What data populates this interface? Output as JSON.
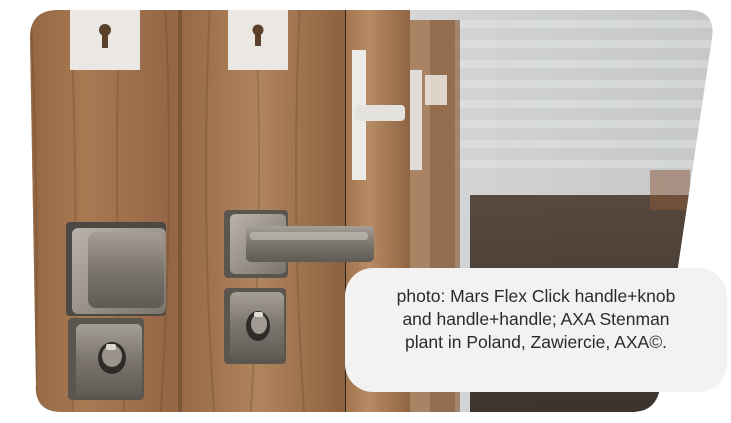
{
  "photo": {
    "subject": "door handles on wooden doors",
    "icons": [
      "handle-plate-icon",
      "knob-plate-icon",
      "keyhole-escutcheon-icon",
      "cylinder-rosette-icon"
    ],
    "colors": {
      "wood": "#9a6c47",
      "metal": "#7d7770",
      "background_blur": "#c9ccce",
      "caption_bg": "#f2f2f2",
      "caption_text": "#2b2b2b"
    }
  },
  "caption": {
    "text": "photo: Mars Flex Click handle+knob\nand handle+handle; AXA Stenman\nplant in Poland, Zawiercie, AXA©."
  }
}
